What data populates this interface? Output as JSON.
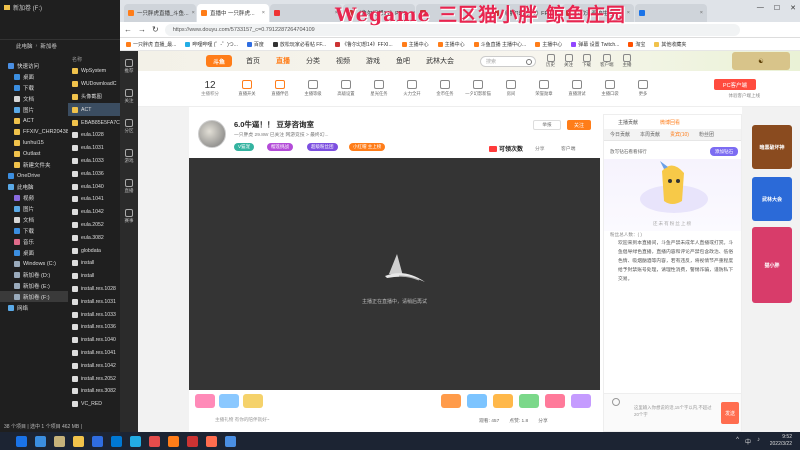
{
  "overlay_title": "Wegame 三区猫小胖 鲸鱼庄园",
  "explorer": {
    "title": "新加卷 (F:)",
    "address": [
      "此电脑",
      "新加卷"
    ],
    "nav": [
      {
        "label": "快速访问",
        "color": "#4a8fe3",
        "indent": false
      },
      {
        "label": "桌面",
        "color": "#3b8ee0",
        "indent": true
      },
      {
        "label": "下载",
        "color": "#3b8ee0",
        "indent": true
      },
      {
        "label": "文档",
        "color": "#d6d6d6",
        "indent": true
      },
      {
        "label": "图片",
        "color": "#5aa9e6",
        "indent": true
      },
      {
        "label": "ACT",
        "color": "#f0c24b",
        "indent": true
      },
      {
        "label": "FFXIV_CHR20438",
        "color": "#f0c24b",
        "indent": true
      },
      {
        "label": "lunhui15",
        "color": "#f0c24b",
        "indent": true
      },
      {
        "label": "Outlast",
        "color": "#f0c24b",
        "indent": true
      },
      {
        "label": "新建文件夹",
        "color": "#f0c24b",
        "indent": true
      },
      {
        "label": "OneDrive",
        "color": "#3b8ee0",
        "indent": false
      },
      {
        "label": "此电脑",
        "color": "#5aa9e6",
        "indent": false
      },
      {
        "label": "视频",
        "color": "#8a6be0",
        "indent": true
      },
      {
        "label": "图片",
        "color": "#5aa9e6",
        "indent": true
      },
      {
        "label": "文档",
        "color": "#d6d6d6",
        "indent": true
      },
      {
        "label": "下载",
        "color": "#3b8ee0",
        "indent": true
      },
      {
        "label": "音乐",
        "color": "#e06b8a",
        "indent": true
      },
      {
        "label": "桌面",
        "color": "#3b8ee0",
        "indent": true
      },
      {
        "label": "Windows (C:)",
        "color": "#9ab",
        "indent": true
      },
      {
        "label": "新加卷 (D:)",
        "color": "#9ab",
        "indent": true
      },
      {
        "label": "新加卷 (E:)",
        "color": "#9ab",
        "indent": true
      },
      {
        "label": "新加卷 (F:)",
        "color": "#9ab",
        "indent": true,
        "selected": true
      },
      {
        "label": "网络",
        "color": "#5aa9e6",
        "indent": false
      }
    ],
    "files_header": "名称",
    "files": [
      {
        "name": "WpSystem",
        "color": "#f0c24b"
      },
      {
        "name": "WUDownloadC",
        "color": "#f0c24b"
      },
      {
        "name": "头像截图",
        "color": "#f0c24b"
      },
      {
        "name": "ACT",
        "color": "#f0c24b",
        "selected": true
      },
      {
        "name": "EBAB85E5FA7C",
        "color": "#f0c24b"
      },
      {
        "name": "eula.1028",
        "color": "#ddd"
      },
      {
        "name": "eula.1031",
        "color": "#ddd"
      },
      {
        "name": "eula.1033",
        "color": "#ddd"
      },
      {
        "name": "eula.1036",
        "color": "#ddd"
      },
      {
        "name": "eula.1040",
        "color": "#ddd"
      },
      {
        "name": "eula.1041",
        "color": "#ddd"
      },
      {
        "name": "eula.1042",
        "color": "#ddd"
      },
      {
        "name": "eula.2052",
        "color": "#ddd"
      },
      {
        "name": "eula.3082",
        "color": "#ddd"
      },
      {
        "name": "globdata",
        "color": "#ddd"
      },
      {
        "name": "install",
        "color": "#ddd"
      },
      {
        "name": "install",
        "color": "#ddd"
      },
      {
        "name": "install.res.1028",
        "color": "#ddd"
      },
      {
        "name": "install.res.1031",
        "color": "#ddd"
      },
      {
        "name": "install.res.1033",
        "color": "#ddd"
      },
      {
        "name": "install.res.1036",
        "color": "#ddd"
      },
      {
        "name": "install.res.1040",
        "color": "#ddd"
      },
      {
        "name": "install.res.1041",
        "color": "#ddd"
      },
      {
        "name": "install.res.1042",
        "color": "#ddd"
      },
      {
        "name": "install.res.2052",
        "color": "#ddd"
      },
      {
        "name": "install.res.3082",
        "color": "#ddd"
      },
      {
        "name": "VC_RED",
        "color": "#ddd"
      }
    ],
    "status": "38 个项目 | 选中 1 个项目 462 MB |"
  },
  "browser": {
    "tabs": [
      {
        "label": "一只胖虎直播_斗鱼...",
        "color": "#ff7d19"
      },
      {
        "label": "直播中 一只胖虎...",
        "color": "#ff7d19",
        "active": true
      },
      {
        "label": "",
        "color": "#e33"
      },
      {
        "label": "《鲁尔幻想14》FFX...",
        "color": "#c33"
      },
      {
        "label": "",
        "color": "#c33"
      },
      {
        "label": "《鲁尔幻想14》FFXIV...",
        "color": "#c33"
      },
      {
        "label": "艾欧泽亚的生存...",
        "color": "#c33"
      },
      {
        "label": "",
        "color": "#1a73e8"
      }
    ],
    "url": "https://www.douyu.com/5733157_c=0.7912287264704109",
    "bookmarks": [
      {
        "label": "一只胖虎 直播_最...",
        "color": "#ff7d19"
      },
      {
        "label": "哔哩哔哩 (゜-゜)つ...",
        "color": "#23ade5"
      },
      {
        "label": "百度",
        "color": "#2f6de1"
      },
      {
        "label": "放松玩家必看帖 FF...",
        "color": "#333"
      },
      {
        "label": "《鲁尔幻想14》FFXI...",
        "color": "#c33"
      },
      {
        "label": "主播中心",
        "color": "#ff7d19"
      },
      {
        "label": "主播中心",
        "color": "#ff7d19"
      },
      {
        "label": "斗鱼直播 主播中心...",
        "color": "#ff7d19"
      },
      {
        "label": "主播中心",
        "color": "#ff7d19"
      },
      {
        "label": "弹幕 设置 Twitch...",
        "color": "#9146ff"
      },
      {
        "label": "淘宝",
        "color": "#ff5000"
      },
      {
        "label": "其他收藏夹",
        "color": "#f0c24b"
      }
    ]
  },
  "site": {
    "left_rail": [
      "推荐",
      "关注",
      "分区",
      "游戏",
      "直播",
      "赛事"
    ],
    "logo": "斗鱼",
    "nav": [
      "首页",
      "直播",
      "分类",
      "视频",
      "游戏",
      "鱼吧",
      "武林大会"
    ],
    "search_placeholder": "搜索",
    "header_icons": [
      "历史",
      "关注",
      "下载",
      "客户端",
      "主播"
    ],
    "online_count": "12",
    "online_label": "主播积分",
    "tools": [
      "直播开关",
      "直播伴侣",
      "主播等级",
      "高级设置",
      "星光任务",
      "火力全开",
      "金币任务",
      "一夕幻影新猫",
      "房间",
      "荣誉勋章",
      "直播测试",
      "主播口袋",
      "更多"
    ],
    "pc_btn": "PC客户端",
    "pc_sub": "体验客户端上线",
    "ads_left": [],
    "ads_right": [
      "暗黑破坏神",
      "武林大会",
      "猫小胖"
    ]
  },
  "room": {
    "title": "6.0牛逼！！ 豆芽咨询室",
    "meta": "一只胖虎  29.8W  已关注  网游竞技 > 最终幻...",
    "tags": [
      {
        "label": "V猫宠",
        "color": "#34b3a0"
      },
      {
        "label": "榴莲挑战",
        "color": "#b34bd8"
      },
      {
        "label": "超级粉丝团",
        "color": "#7c4fe0"
      },
      {
        "label": "小红帽 主上榜",
        "color": "#ff7d19"
      }
    ],
    "report": "举报",
    "follow": "关注",
    "claim": "可领次数",
    "share": "分享",
    "more": "客户端",
    "player_msg": "主播正在直播中，请稍后再试",
    "gift_input": "主播礼物  有你的陪伴就好~",
    "gift_stats": [
      "观看: 457",
      "点赞: 1.8",
      "分享"
    ]
  },
  "chat": {
    "top": [
      "主播贡献",
      "微博回看"
    ],
    "tabs": [
      "今日贡献",
      "本周贡献",
      "贵宾(10)",
      "粉丝团"
    ],
    "active_tab": 2,
    "cheer": "放写钻石看看排行",
    "cheer_btn": "添加钻石",
    "mascot_text": "还未有粉丝上榜",
    "fans": "粉丝总人数：(   )",
    "notice": "欢迎来到本直播间，斗鱼严禁未成年人直播或打赏。斗鱼倡导绿色直播，直播内容和评论严禁包含政治、低俗色情、吸烟酗酒等内容，若有违反，将视情节严重程度给予封禁账号处理，请理性消费，警惕诈骗，谨防私下交易。",
    "input_ph": "这里输入你想说的话,15个字以内,不超过20个字",
    "send": "发送"
  },
  "taskbar": {
    "clock": "9:52",
    "date": "2022/3/22",
    "tray": [
      "^",
      "中",
      "♪"
    ],
    "icons": [
      "#1a73e8",
      "#3b8ee0",
      "#c6b27a",
      "#f0c24b",
      "#2f6de1",
      "#0078d4",
      "#23ade5",
      "#e34c4c",
      "#ff7d19",
      "#c33",
      "#ff6d4f",
      "#4a8fe3"
    ]
  },
  "colors": {
    "accent": "#ff7d19",
    "overlay_red": "#e8254f"
  }
}
